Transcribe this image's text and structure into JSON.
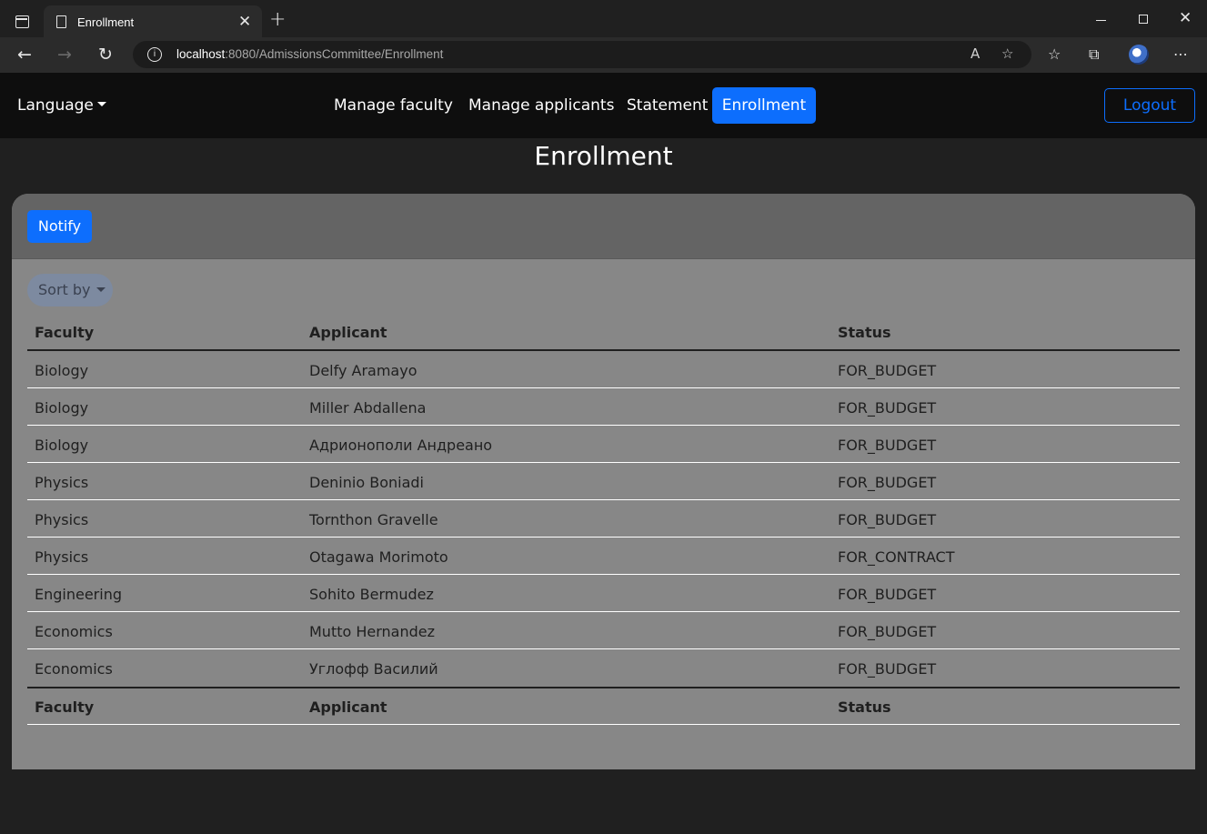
{
  "browser": {
    "tab_title": "Enrollment",
    "url_host": "localhost",
    "url_rest": ":8080/AdmissionsCommittee/Enrollment"
  },
  "navbar": {
    "language_label": "Language",
    "links": [
      "Manage faculty",
      "Manage applicants",
      "Statement"
    ],
    "active_label": "Enrollment",
    "logout_label": "Logout"
  },
  "page": {
    "title": "Enrollment",
    "notify_label": "Notify",
    "sort_label": "Sort by"
  },
  "table": {
    "headers": [
      "Faculty",
      "Applicant",
      "Status"
    ],
    "rows": [
      [
        "Biology",
        "Delfy Aramayo",
        "FOR_BUDGET"
      ],
      [
        "Biology",
        "Miller Abdallena",
        "FOR_BUDGET"
      ],
      [
        "Biology",
        "Адрионополи Андреано",
        "FOR_BUDGET"
      ],
      [
        "Physics",
        "Deninio Boniadi",
        "FOR_BUDGET"
      ],
      [
        "Physics",
        "Tornthon Gravelle",
        "FOR_BUDGET"
      ],
      [
        "Physics",
        "Otagawa Morimoto",
        "FOR_CONTRACT"
      ],
      [
        "Engineering",
        "Sohito Bermudez",
        "FOR_BUDGET"
      ],
      [
        "Economics",
        "Mutto Hernandez",
        "FOR_BUDGET"
      ],
      [
        "Economics",
        "Углофф Василий",
        "FOR_BUDGET"
      ]
    ]
  }
}
